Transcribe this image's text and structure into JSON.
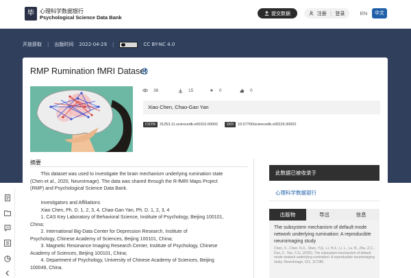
{
  "header": {
    "logo_glyph": "毕",
    "logo_cn": "心理科学数据银行",
    "logo_en": "Psychological Science Data Bank",
    "submit_label": "提交数据",
    "register_label": "注册",
    "login_label": "登录",
    "lang_en": "EN",
    "lang_cn": "中文",
    "accent": "#1f5fa8"
  },
  "meta": {
    "access": "开放获取",
    "publish_label": "出版时间",
    "publish_date": "2022-04-29",
    "license": "CC BY-NC 4.0"
  },
  "dataset": {
    "title": "RMP Rumination fMRI Dataset",
    "stats": {
      "views": "36",
      "downloads": "15",
      "stars": "0",
      "likes": "0"
    },
    "authors": "Xiao Chen,  Chao-Gan Yan",
    "cstr_label": "CSTR",
    "cstr_value": "31253.11.sciencedb.o00115.00002",
    "doi_label": "DOI",
    "doi_value": "10.57760/sciencedb.o00115.00002"
  },
  "abstract": {
    "heading": "摘要",
    "lines": [
      "        This dataset was used to investigate the brain mechanism underlying rumination state",
      "(Chen et al., 2020, NeuroImage). The data was shared through the R-fMRI Maps Project",
      "(RMP) and Psychological Science Data Bank.",
      "",
      "        Investigators and Affiliations",
      "        Xiao Chen, Ph. D. 1, 2, 3, 4, Chao-Gan Yan, Ph. D. 1, 2, 3, 4",
      "        1.    CAS Key Laboratory of Behavioral Science, Institute of Psychology, Beijing 100101,",
      "China;",
      "        2.    International Big-Data Center for Depression Research, Institute of",
      "Psychology, Chinese Academy of Sciences, Beijing 100101, China;",
      "        3.    Magnetic Resonance Imaging Research Center, Institute of Psychology, Chinese",
      "Academy of Sciences, Beijing 100101, China;",
      "        4.    Department of Psychology, University of Chinese Academy of Sciences, Beijing",
      "100049, China."
    ]
  },
  "side": {
    "indexed_title": "此数据已被收录于",
    "indexed_link": "心理科学数据银行",
    "tabs": [
      "出版物",
      "导出",
      "信息"
    ],
    "active_tab": 0,
    "pub_title": "The subsystem mechanism of default mode network underlying rumination: A reproducible neuroimaging study",
    "pub_cite": "Chen, X., Chen, N.X., Shen, Y.Q., Li, H.X., Li, L., Lu, B., Zhu, Z.C., Fan, Z., Yan, C.G. (2020). The subsystem mechanism of default mode network underlying rumination: A reproducible neuroimaging study. NeuroImage, 221, 117185."
  },
  "toolbar": {
    "icons": [
      "document-icon",
      "folder-icon",
      "chat-icon",
      "list-icon",
      "chart-icon",
      "collapse-icon"
    ]
  }
}
